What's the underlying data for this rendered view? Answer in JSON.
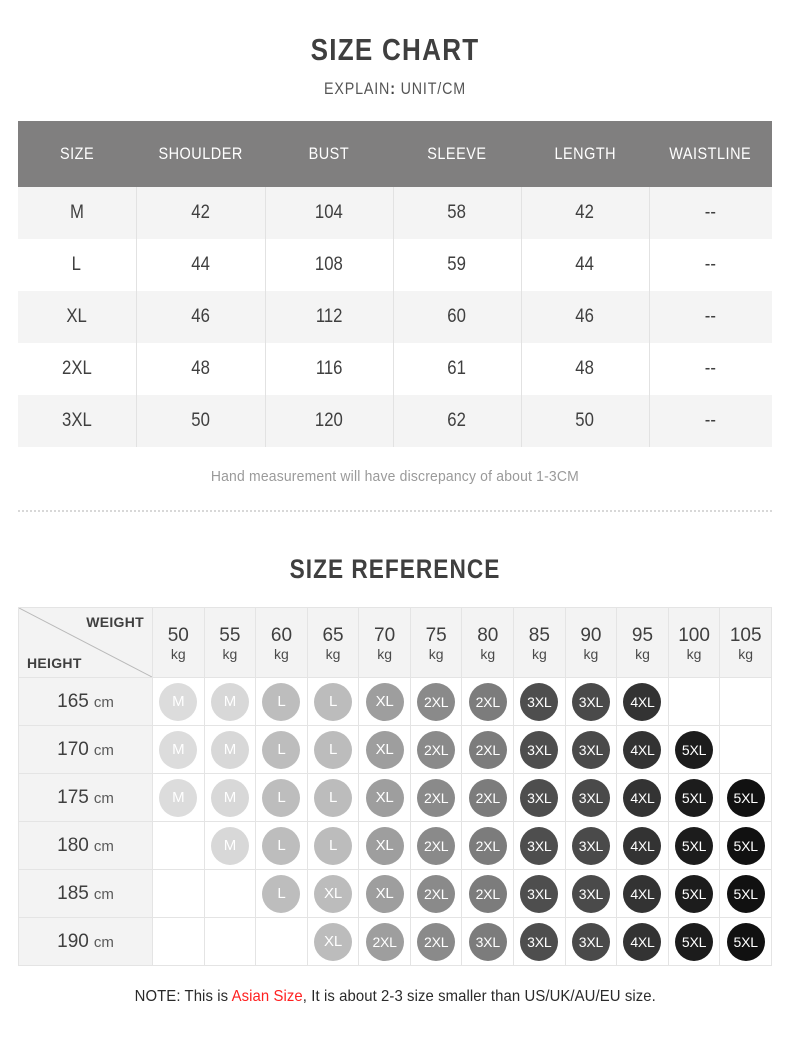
{
  "header": {
    "title": "SIZE CHART",
    "explain_label": "EXPLAIN",
    "explain_colon": ":",
    "explain_value": "UNIT/CM"
  },
  "size_chart": {
    "columns": [
      "SIZE",
      "SHOULDER",
      "BUST",
      "SLEEVE",
      "LENGTH",
      "WAISTLINE"
    ],
    "rows": [
      {
        "size": "M",
        "shoulder": "42",
        "bust": "104",
        "sleeve": "58",
        "length": "42",
        "waistline": "--"
      },
      {
        "size": "L",
        "shoulder": "44",
        "bust": "108",
        "sleeve": "59",
        "length": "44",
        "waistline": "--"
      },
      {
        "size": "XL",
        "shoulder": "46",
        "bust": "112",
        "sleeve": "60",
        "length": "46",
        "waistline": "--"
      },
      {
        "size": "2XL",
        "shoulder": "48",
        "bust": "116",
        "sleeve": "61",
        "length": "48",
        "waistline": "--"
      },
      {
        "size": "3XL",
        "shoulder": "50",
        "bust": "120",
        "sleeve": "62",
        "length": "50",
        "waistline": "--"
      }
    ],
    "footnote": "Hand measurement will have discrepancy of about 1-3CM"
  },
  "reference": {
    "title": "SIZE REFERENCE",
    "corner": {
      "weight_label": "WEIGHT",
      "height_label": "HEIGHT"
    },
    "weight_unit": "kg",
    "weights": [
      "50",
      "55",
      "60",
      "65",
      "70",
      "75",
      "80",
      "85",
      "90",
      "95",
      "100",
      "105"
    ],
    "height_unit": "cm",
    "heights": [
      "165",
      "170",
      "175",
      "180",
      "185",
      "190"
    ],
    "grid": [
      [
        "M",
        "M",
        "L",
        "L",
        "XL",
        "2XL",
        "2XL",
        "3XL",
        "3XL",
        "4XL",
        "",
        ""
      ],
      [
        "M",
        "M",
        "L",
        "L",
        "XL",
        "2XL",
        "2XL",
        "3XL",
        "3XL",
        "4XL",
        "5XL",
        ""
      ],
      [
        "M",
        "M",
        "L",
        "L",
        "XL",
        "2XL",
        "2XL",
        "3XL",
        "3XL",
        "4XL",
        "5XL",
        "5XL"
      ],
      [
        "",
        "M",
        "L",
        "L",
        "XL",
        "2XL",
        "2XL",
        "3XL",
        "3XL",
        "4XL",
        "5XL",
        "5XL"
      ],
      [
        "",
        "",
        "L",
        "XL",
        "XL",
        "2XL",
        "2XL",
        "3XL",
        "3XL",
        "4XL",
        "5XL",
        "5XL"
      ],
      [
        "",
        "",
        "",
        "XL",
        "2XL",
        "2XL",
        "3XL",
        "3XL",
        "3XL",
        "4XL",
        "5XL",
        "5XL"
      ]
    ],
    "bubble_colors": [
      "#dcdcdc",
      "#d8d8d8",
      "#bdbdbd",
      "#bcbcbc",
      "#9e9e9e",
      "#8a8a8a",
      "#7c7c7c",
      "#4e4e4e",
      "#4a4a4a",
      "#333333",
      "#1c1c1c",
      "#111111"
    ]
  },
  "bottom_note": {
    "prefix": "NOTE: This is ",
    "highlight": "Asian Size",
    "suffix": ", It is about 2-3 size smaller than US/UK/AU/EU size."
  },
  "colors": {
    "header_gray": "#807f7f",
    "stripe_gray": "#f4f4f4",
    "accent_red": "#ff2020",
    "text_dark": "#3f3f3f"
  }
}
